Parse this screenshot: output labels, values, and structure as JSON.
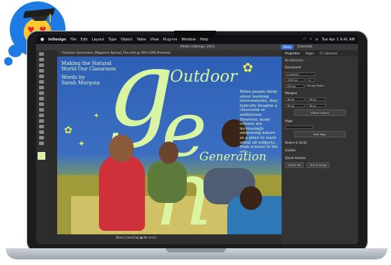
{
  "menubar": {
    "apple": "",
    "items": [
      "InDesign",
      "File",
      "Edit",
      "Layout",
      "Type",
      "Object",
      "Table",
      "View",
      "Plug-ins",
      "Window",
      "Help"
    ],
    "datetime": "Tue Apr 1  9:41 AM"
  },
  "window": {
    "title": "Adobe InDesign 2023",
    "share_label": "Share",
    "workspace": "Essentials"
  },
  "document": {
    "tab_label": "*Outdoor Generation_Magazine Spread_Tile.indd @ 50% [GPU Preview]"
  },
  "spread": {
    "left_title": [
      "Making the Natural",
      "World Our Classroom"
    ],
    "byline": [
      "Words by",
      "Sarah Murguia"
    ],
    "headline_top": "Outdoor",
    "headline_bottom": "Generation",
    "big_letters": [
      "g",
      "e",
      "n"
    ],
    "body": "When people think about learning environments, they typically imagine a classroom or auditorium. However, many schools are increasingly embracing nature as a place to learn about all subjects, from science to the arts."
  },
  "status_bar": {
    "text": "[Basic] (working)   ●  No errors"
  },
  "panel": {
    "tabs": [
      "Properties",
      "Pages",
      "CC Libraries"
    ],
    "selection": "No Selection",
    "document_label": "Document",
    "doc_preset": "[Custom]",
    "width": "1350 px",
    "height": "900 px",
    "pages_count": "4",
    "facing_pages": "Facing Pages",
    "margins_label": "Margins",
    "margin_values": [
      "36 px",
      "36 px",
      "36 px",
      "36 px"
    ],
    "adjust_layout": "Adjust Layout",
    "page_label": "Page",
    "edit_page": "Edit Page",
    "rulers_grids": "Rulers & Grids",
    "guides": "Guides",
    "quick_actions": "Quick Actions",
    "import_file": "Import File",
    "text_to_image": "Text to Image"
  },
  "colors": {
    "accent": "#1e7be4",
    "headline": "#d9f5a2",
    "share": "#3b73d6"
  },
  "badge": {
    "icon": "heart-eyes-graduate-emoji"
  }
}
